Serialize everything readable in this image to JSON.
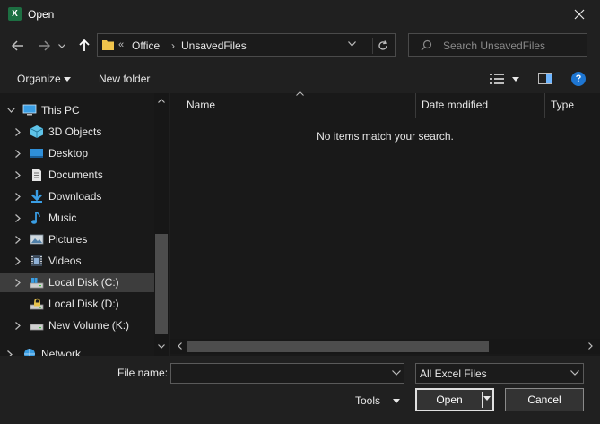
{
  "window": {
    "title": "Open",
    "app_icon_letter": "X",
    "app_icon": "excel-icon"
  },
  "navbar": {
    "back_icon": "arrow-left-icon",
    "forward_icon": "arrow-right-icon",
    "recent_icon": "chevron-down-icon",
    "up_icon": "arrow-up-icon",
    "address": {
      "overflow": "«",
      "crumbs": [
        "Office",
        "UnsavedFiles"
      ],
      "separator": "›"
    },
    "search": {
      "placeholder": "Search UnsavedFiles"
    }
  },
  "toolbar": {
    "organize_label": "Organize",
    "new_folder_label": "New folder",
    "help_label": "?"
  },
  "nav_tree": [
    {
      "label": "This PC",
      "icon": "computer-icon",
      "level": 0,
      "expanded": true
    },
    {
      "label": "3D Objects",
      "icon": "cube-icon",
      "level": 1
    },
    {
      "label": "Desktop",
      "icon": "desktop-icon",
      "level": 1
    },
    {
      "label": "Documents",
      "icon": "documents-icon",
      "level": 1
    },
    {
      "label": "Downloads",
      "icon": "download-icon",
      "level": 1
    },
    {
      "label": "Music",
      "icon": "music-icon",
      "level": 1
    },
    {
      "label": "Pictures",
      "icon": "pictures-icon",
      "level": 1
    },
    {
      "label": "Videos",
      "icon": "video-icon",
      "level": 1
    },
    {
      "label": "Local Disk (C:)",
      "icon": "drive-icon",
      "level": 1,
      "selected": true
    },
    {
      "label": "Local Disk (D:)",
      "icon": "drive-icon",
      "level": 1
    },
    {
      "label": "New Volume (K:)",
      "icon": "drive-icon",
      "level": 1
    },
    {
      "label": "Network",
      "icon": "network-icon",
      "level": 0
    }
  ],
  "content": {
    "columns": [
      "Name",
      "Date modified",
      "Type"
    ],
    "empty_message": "No items match your search."
  },
  "bottom": {
    "file_name_label": "File name:",
    "file_name_value": "",
    "file_type_value": "All Excel Files",
    "tools_label": "Tools",
    "open_label": "Open",
    "cancel_label": "Cancel"
  },
  "colors": {
    "background": "#1f1f1f",
    "pane": "#191919",
    "selected": "#3d3d3d",
    "accent": "#1e76d2",
    "excel_green": "#1d6f42",
    "folder_yellow": "#f0c44c"
  }
}
